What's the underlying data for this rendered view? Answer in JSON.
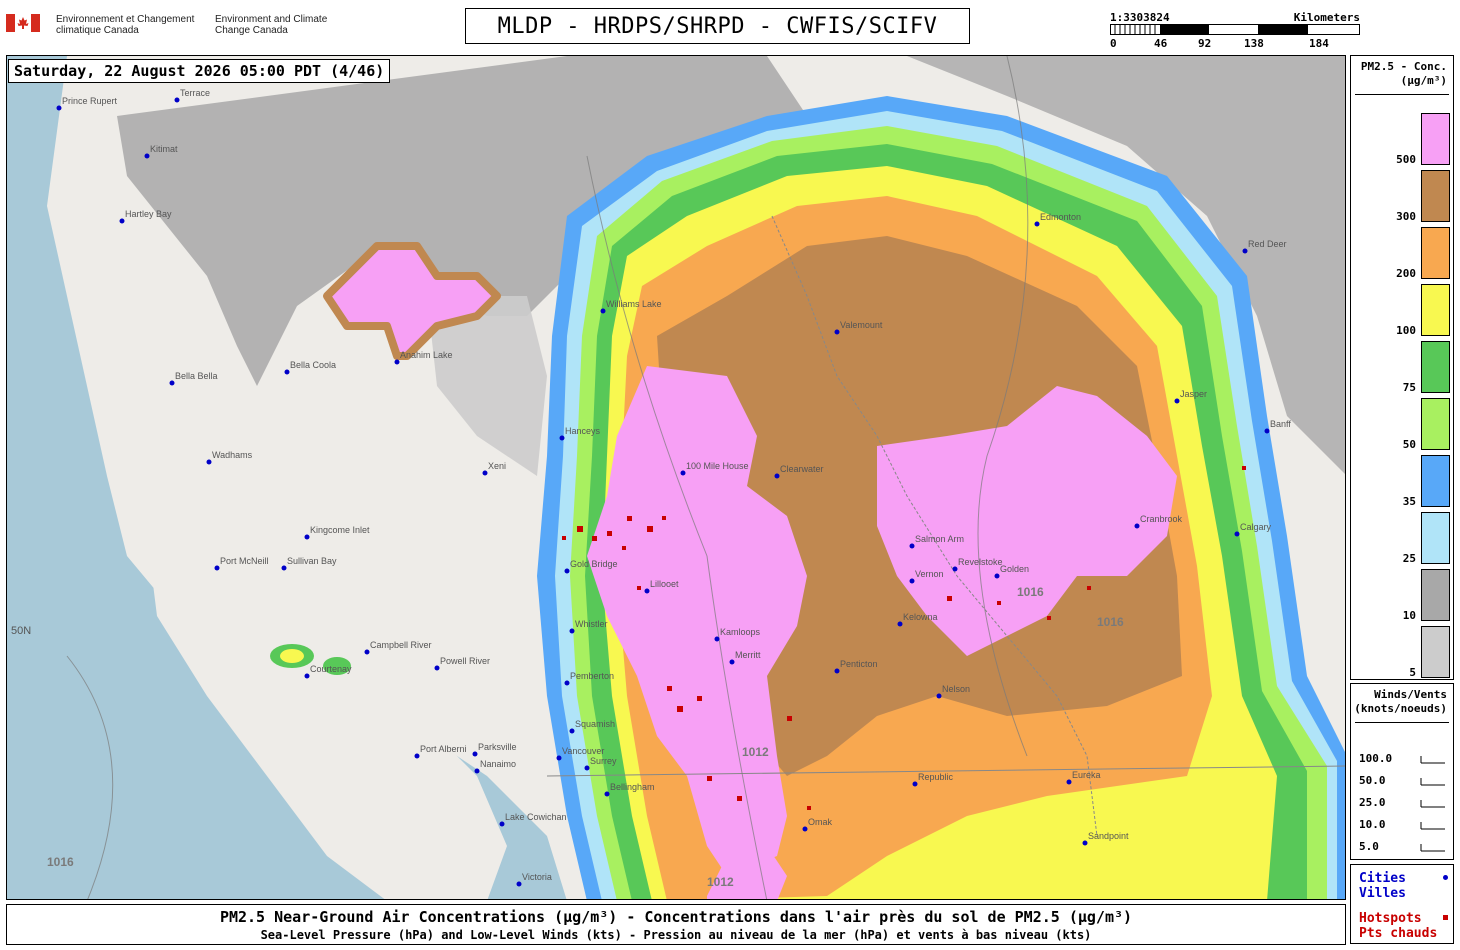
{
  "header": {
    "agency_fr": "Environnement et Changement climatique Canada",
    "agency_en": "Environment and Climate Change Canada",
    "title": "MLDP - HRDPS/SHRPD - CWFIS/SCIFV",
    "scale": {
      "ratio": "1:3303824",
      "unit": "Kilometers",
      "ticks": [
        "0",
        "46",
        "92",
        "138",
        "184"
      ]
    }
  },
  "map": {
    "timestamp": "Saturday, 22 August 2026 05:00 PDT (4/46)",
    "lat_label": "50N",
    "isobars": [
      "1016",
      "1012",
      "1016",
      "1012",
      "1016"
    ],
    "places": [
      "Prince Rupert",
      "Terrace",
      "Kitimat",
      "Hartley Bay",
      "Bella Bella",
      "Bella Coola",
      "Anahim Lake",
      "Williams Lake",
      "Hanceys",
      "100 Mile House",
      "Kamloops",
      "Merritt",
      "Valemount",
      "Clearwater",
      "Salmon Arm",
      "Vernon",
      "Kelowna",
      "Penticton",
      "Pemberton",
      "Whistler",
      "Squamish",
      "Vancouver",
      "Surrey",
      "Bellingham",
      "Nanaimo",
      "Victoria",
      "Port Alberni",
      "Campbell River",
      "Courtenay",
      "Powell River",
      "Port McNeill",
      "Wadhams",
      "Kingcome Inlet",
      "Sullivan Bay",
      "Xeni",
      "Gold Bridge",
      "Lillooet",
      "Revelstoke",
      "Golden",
      "Nelson",
      "Cranbrook",
      "Calgary",
      "Red Deer",
      "Edmonton",
      "Jasper",
      "Banff",
      "Lake Cowichan",
      "Parksville",
      "Omak",
      "Republic",
      "Sandpoint",
      "Eureka"
    ],
    "accent_colors": {
      "pink": "#f7a0f5",
      "brown": "#c08850",
      "orange": "#f8a850",
      "yellow": "#f8f850",
      "green_dark": "#58c858",
      "green_light": "#a8f060",
      "blue": "#58a8f8",
      "blue_light": "#b0e4f8",
      "gray": "#a8a8a8",
      "gray_light": "#cccccc",
      "city": "#0000c8",
      "hotspot": "#c80000"
    }
  },
  "legend_pm": {
    "title": "PM2.5 - Conc.",
    "unit": "(µg/m³)",
    "levels": [
      {
        "label": "500",
        "color": "#f7a0f5"
      },
      {
        "label": "300",
        "color": "#c08850"
      },
      {
        "label": "200",
        "color": "#f8a850"
      },
      {
        "label": "100",
        "color": "#f8f850"
      },
      {
        "label": "75",
        "color": "#58c858"
      },
      {
        "label": "50",
        "color": "#a8f060"
      },
      {
        "label": "35",
        "color": "#58a8f8"
      },
      {
        "label": "25",
        "color": "#b0e4f8"
      },
      {
        "label": "10",
        "color": "#a8a8a8"
      },
      {
        "label": "5",
        "color": "#cccccc"
      }
    ]
  },
  "legend_wind": {
    "title": "Winds/Vents",
    "unit": "(knots/noeuds)",
    "rows": [
      "100.0",
      "50.0",
      "25.0",
      "10.0",
      "5.0"
    ]
  },
  "legend_points": {
    "cities_en": "Cities",
    "cities_fr": "Villes",
    "hotspots_en": "Hotspots",
    "hotspots_fr": "Pts chauds"
  },
  "footer": {
    "line1": "PM2.5 Near-Ground Air Concentrations (µg/m³) - Concentrations dans l'air près du sol de PM2.5 (µg/m³)",
    "line2": "Sea-Level Pressure (hPa) and Low-Level Winds (kts) - Pression au niveau de la mer (hPa) et vents à bas niveau (kts)"
  }
}
